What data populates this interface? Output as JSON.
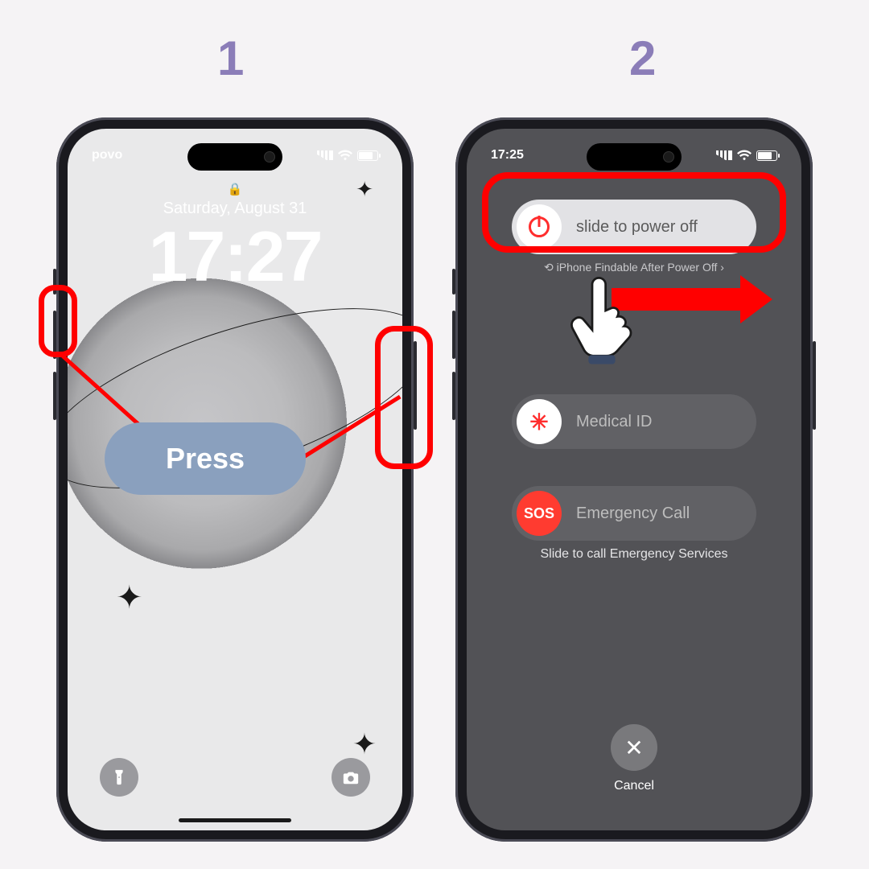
{
  "steps": {
    "one": "1",
    "two": "2"
  },
  "lockscreen": {
    "carrier": "povo",
    "date": "Saturday, August 31",
    "time": "17:27"
  },
  "annotations": {
    "press_label": "Press"
  },
  "poweroff": {
    "time": "17:25",
    "slide_power": "slide to power off",
    "findable": "⟲ iPhone Findable After Power Off  ›",
    "medical": "Medical ID",
    "medical_symbol": "✳",
    "sos_symbol": "SOS",
    "emergency": "Emergency Call",
    "slide_hint": "Slide to call Emergency Services",
    "cancel": "Cancel"
  }
}
